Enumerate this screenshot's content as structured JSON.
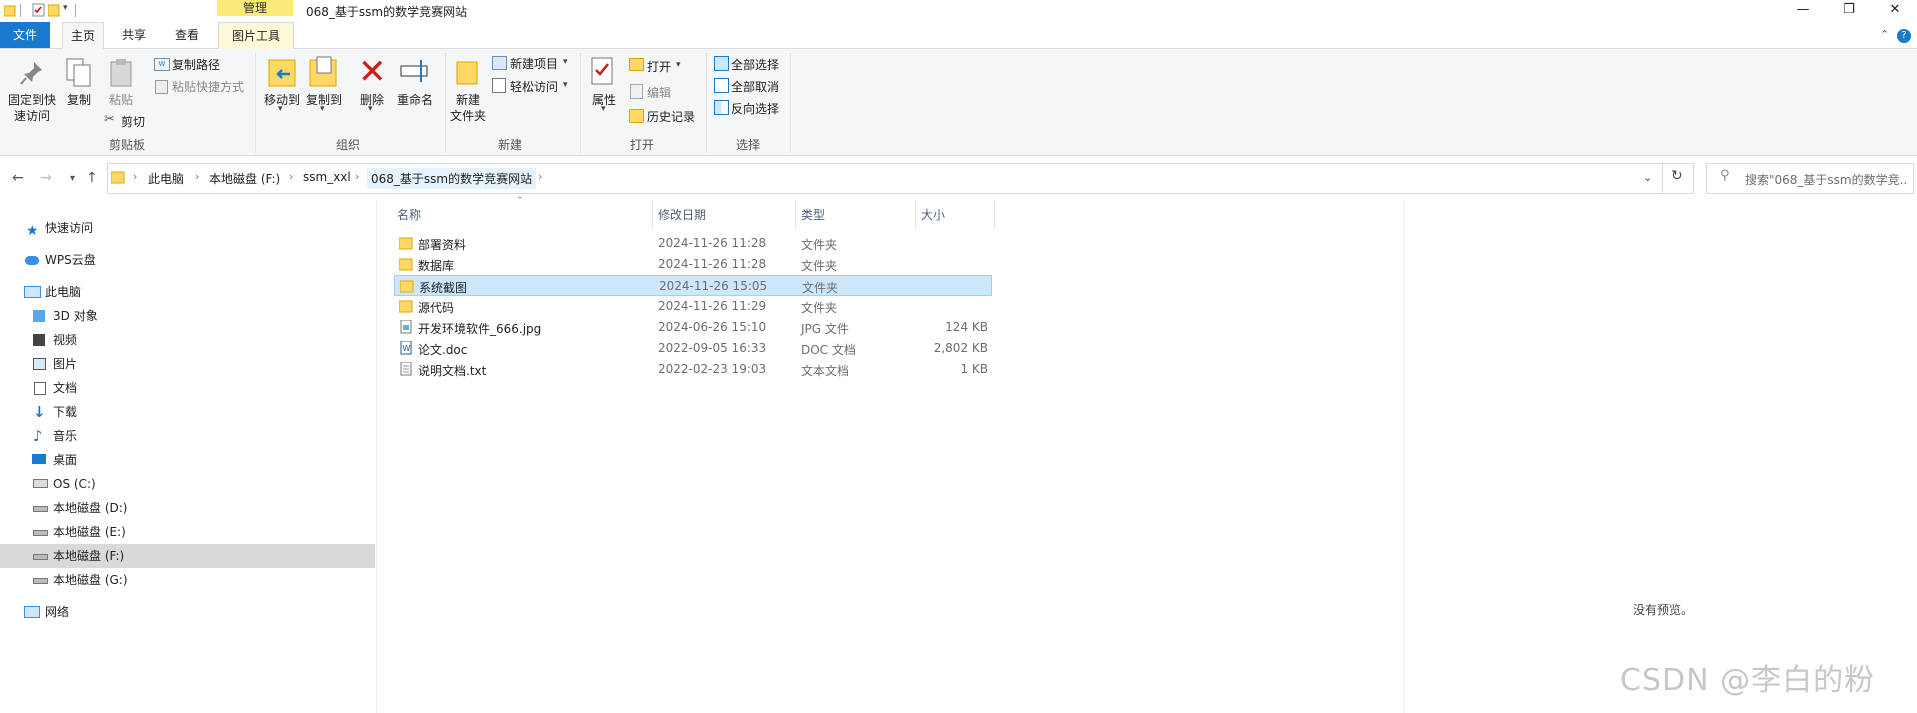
{
  "window": {
    "title": "068_基于ssm的数学竞赛网站",
    "context_tab": "管理",
    "controls": {
      "minimize": "—",
      "maximize": "❐",
      "close": "✕"
    }
  },
  "tabs": {
    "file": "文件",
    "home": "主页",
    "share": "共享",
    "view": "查看",
    "picture_tools": "图片工具"
  },
  "ribbon": {
    "clipboard": {
      "label": "剪贴板",
      "pin": "固定到快\n速访问",
      "copy": "复制",
      "paste": "粘贴",
      "copy_path": "复制路径",
      "paste_shortcut": "粘贴快捷方式",
      "cut": "剪切"
    },
    "organize": {
      "label": "组织",
      "move_to": "移动到",
      "copy_to": "复制到",
      "delete": "删除",
      "rename": "重命名"
    },
    "new": {
      "label": "新建",
      "new_folder": "新建\n文件夹",
      "new_item": "新建项目",
      "easy_access": "轻松访问"
    },
    "open": {
      "label": "打开",
      "properties": "属性",
      "open": "打开",
      "edit": "编辑",
      "history": "历史记录"
    },
    "select": {
      "label": "选择",
      "select_all": "全部选择",
      "select_none": "全部取消",
      "invert": "反向选择"
    }
  },
  "address": {
    "crumbs": [
      "此电脑",
      "本地磁盘 (F:)",
      "ssm_xxl",
      "068_基于ssm的数学竞赛网站"
    ],
    "search_placeholder": "搜索\"068_基于ssm的数学竞..."
  },
  "nav": {
    "quick_access": "快速访问",
    "wps": "WPS云盘",
    "this_pc": "此电脑",
    "items": [
      "3D 对象",
      "视频",
      "图片",
      "文档",
      "下载",
      "音乐",
      "桌面",
      "OS (C:)",
      "本地磁盘 (D:)",
      "本地磁盘 (E:)",
      "本地磁盘 (F:)",
      "本地磁盘 (G:)"
    ],
    "network": "网络"
  },
  "columns": {
    "name": "名称",
    "date": "修改日期",
    "type": "类型",
    "size": "大小"
  },
  "files": [
    {
      "name": "部署资料",
      "date": "2024-11-26 11:28",
      "type": "文件夹",
      "size": "",
      "icon": "folder-icon"
    },
    {
      "name": "数据库",
      "date": "2024-11-26 11:28",
      "type": "文件夹",
      "size": "",
      "icon": "folder-icon"
    },
    {
      "name": "系统截图",
      "date": "2024-11-26 15:05",
      "type": "文件夹",
      "size": "",
      "icon": "folder-icon"
    },
    {
      "name": "源代码",
      "date": "2024-11-26 11:29",
      "type": "文件夹",
      "size": "",
      "icon": "folder-icon"
    },
    {
      "name": "开发环境软件_666.jpg",
      "date": "2024-06-26 15:10",
      "type": "JPG 文件",
      "size": "124 KB",
      "icon": "image-file-icon"
    },
    {
      "name": "论文.doc",
      "date": "2022-09-05 16:33",
      "type": "DOC 文档",
      "size": "2,802 KB",
      "icon": "word-file-icon"
    },
    {
      "name": "说明文档.txt",
      "date": "2022-02-23 19:03",
      "type": "文本文档",
      "size": "1 KB",
      "icon": "text-file-icon"
    }
  ],
  "preview": {
    "empty": "没有预览。"
  },
  "watermark": "CSDN @李白的粉",
  "colors": {
    "accent": "#1979ca",
    "selection": "#cce8ff",
    "folder": "#ffd865",
    "manage_tab": "#fbe97a"
  }
}
